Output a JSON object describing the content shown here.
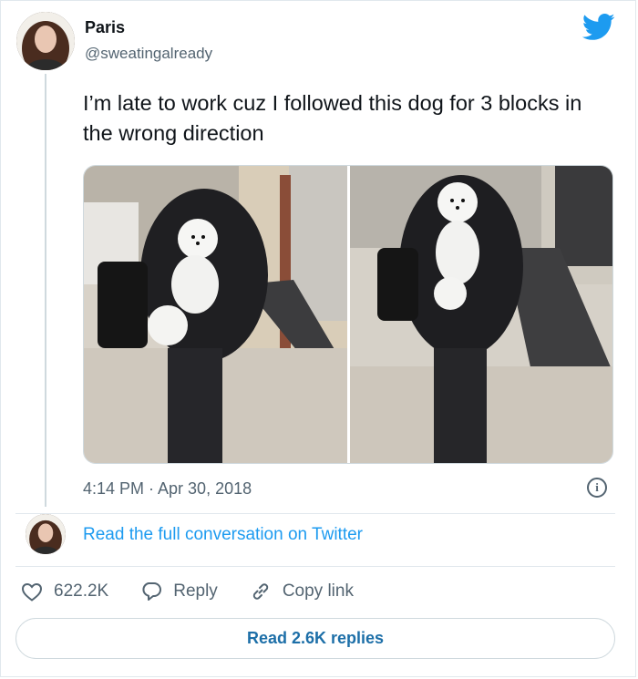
{
  "author": {
    "name": "Paris",
    "handle": "@sweatingalready"
  },
  "tweet": {
    "text": "I’m late to work cuz I followed this dog for 3 blocks in the wrong direction",
    "timestamp": "4:14 PM · Apr 30, 2018"
  },
  "conversation": {
    "link_label": "Read the full conversation on Twitter"
  },
  "actions": {
    "likes": "622.2K",
    "reply_label": "Reply",
    "copy_label": "Copy link"
  },
  "replies": {
    "button_label": "Read 2.6K replies"
  },
  "icons": [
    "twitter-bird-icon",
    "info-icon",
    "heart-icon",
    "reply-icon",
    "link-icon"
  ],
  "colors": {
    "brand_blue": "#1d9bf0",
    "text_primary": "#0f1419",
    "text_secondary": "#536471",
    "border": "#cfd9de"
  }
}
